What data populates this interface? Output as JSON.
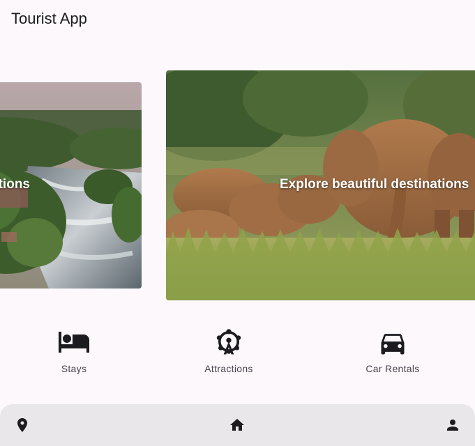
{
  "app_bar": {
    "title": "Tourist App"
  },
  "carousel": {
    "slides": [
      {
        "caption": "Explore beautiful destinations",
        "image": "waterfall-river-photo"
      },
      {
        "caption": "Explore beautiful destinations",
        "image": "elephants-herd-photo"
      }
    ],
    "active_index": 1
  },
  "categories": [
    {
      "label": "Stays",
      "icon": "bed-icon"
    },
    {
      "label": "Attractions",
      "icon": "ferris-wheel-icon"
    },
    {
      "label": "Car Rentals",
      "icon": "car-icon"
    }
  ],
  "bottom_nav": {
    "items": [
      {
        "icon": "location-pin-icon"
      },
      {
        "icon": "home-icon"
      },
      {
        "icon": "person-icon"
      }
    ]
  },
  "colors": {
    "background": "#fcf8fc",
    "nav_background": "#e9e7e9",
    "icon": "#1c1b1f",
    "label": "#49454f"
  }
}
